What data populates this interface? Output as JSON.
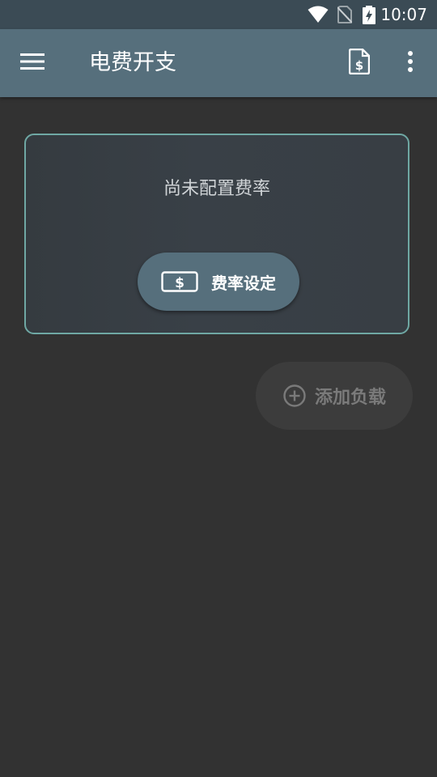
{
  "status_bar": {
    "time": "10:07",
    "icons": [
      "wifi-icon",
      "no-sim-icon",
      "battery-charging-icon"
    ]
  },
  "app_bar": {
    "title": "电费开支",
    "left_icon": "menu-icon",
    "right_icons": [
      "rate-document-icon",
      "overflow-menu-icon"
    ]
  },
  "rate_card": {
    "message": "尚未配置费率",
    "button_label": "费率设定",
    "button_icon": "dollar-bill-icon"
  },
  "add_load": {
    "label": "添加负载",
    "icon": "add-circle-icon"
  },
  "colors": {
    "background": "#323232",
    "status_bar": "#3b4b55",
    "app_bar": "#566f7c",
    "card_border": "#6fa8a4",
    "card_text": "#cfd3d6",
    "button": "#566f7c",
    "add_button": "#3c3c3c",
    "add_text": "#7a7a7a"
  }
}
